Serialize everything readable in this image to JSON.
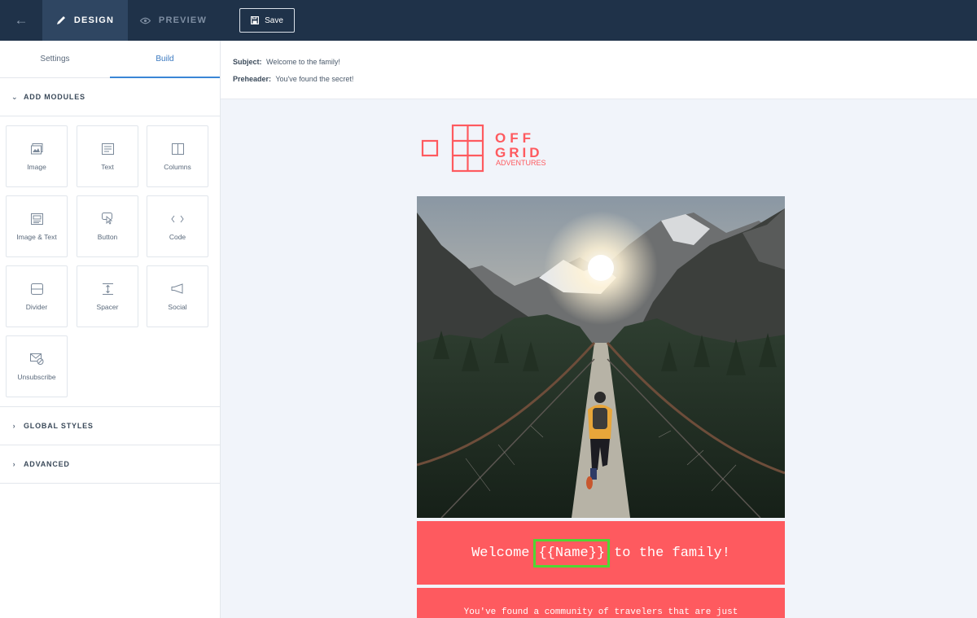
{
  "topbar": {
    "back_icon": "arrow-left-icon",
    "design_label": "DESIGN",
    "preview_label": "PREVIEW",
    "save_label": "Save"
  },
  "sidebar": {
    "tabs": [
      {
        "label": "Settings",
        "active": false
      },
      {
        "label": "Build",
        "active": true
      }
    ],
    "add_modules_label": "ADD MODULES",
    "modules": [
      {
        "label": "Image",
        "icon": "image-icon"
      },
      {
        "label": "Text",
        "icon": "text-icon"
      },
      {
        "label": "Columns",
        "icon": "columns-icon"
      },
      {
        "label": "Image & Text",
        "icon": "image-text-icon"
      },
      {
        "label": "Button",
        "icon": "button-icon"
      },
      {
        "label": "Code",
        "icon": "code-icon"
      },
      {
        "label": "Divider",
        "icon": "divider-icon"
      },
      {
        "label": "Spacer",
        "icon": "spacer-icon"
      },
      {
        "label": "Social",
        "icon": "megaphone-icon"
      },
      {
        "label": "Unsubscribe",
        "icon": "unsubscribe-icon"
      }
    ],
    "global_styles_label": "GLOBAL STYLES",
    "advanced_label": "ADVANCED"
  },
  "email": {
    "subject_label": "Subject:",
    "subject_value": "Welcome to the family!",
    "preheader_label": "Preheader:",
    "preheader_value": "You've found the secret!",
    "logo": {
      "line1": "OFF",
      "line2": "GRID",
      "line3": "ADVENTURES",
      "color": "#fe5a5f"
    },
    "welcome_before": "Welcome",
    "welcome_name": "{{Name}}",
    "welcome_after": "to the family!",
    "body_text": "You've found a community of travelers that are just",
    "accent_color": "#fe5a5f",
    "highlight_color": "#4fd633"
  }
}
